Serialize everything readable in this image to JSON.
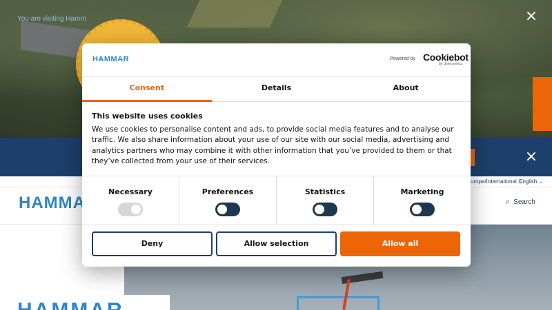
{
  "background": {
    "visit_text": "You are visiting Hamm",
    "region_label": "urope/International ⌄",
    "language_label": "English ⌄",
    "logo_text": "HAMMA",
    "search_label": "Search",
    "hero_title": "HAMMAR",
    "close_glyph": "×"
  },
  "dialog": {
    "logo_text": "HAMMAR",
    "powered_by": "Powered by",
    "cookiebot": "Cookiebot",
    "usercentrics": "by Usercentrics",
    "tabs": [
      {
        "label": "Consent",
        "active": true
      },
      {
        "label": "Details",
        "active": false
      },
      {
        "label": "About",
        "active": false
      }
    ],
    "title": "This website uses cookies",
    "body": "We use cookies to personalise content and ads, to provide social media features and to analyse our traffic. We also share information about your use of our site with our social media, advertising and analytics partners who may combine it with other information that you’ve provided to them or that they’ve collected from your use of their services.",
    "categories": [
      {
        "label": "Necessary",
        "state": "on",
        "disabled": true
      },
      {
        "label": "Preferences",
        "state": "off",
        "disabled": false
      },
      {
        "label": "Statistics",
        "state": "off",
        "disabled": false
      },
      {
        "label": "Marketing",
        "state": "off",
        "disabled": false
      }
    ],
    "buttons": {
      "deny": "Deny",
      "allow_selection": "Allow selection",
      "allow_all": "Allow all"
    }
  },
  "colors": {
    "accent": "#ec6608",
    "brand_blue": "#2e86c8",
    "navy": "#1d3f6b",
    "toggle_off": "#1c3850",
    "toggle_disabled": "#d6d6d6"
  }
}
